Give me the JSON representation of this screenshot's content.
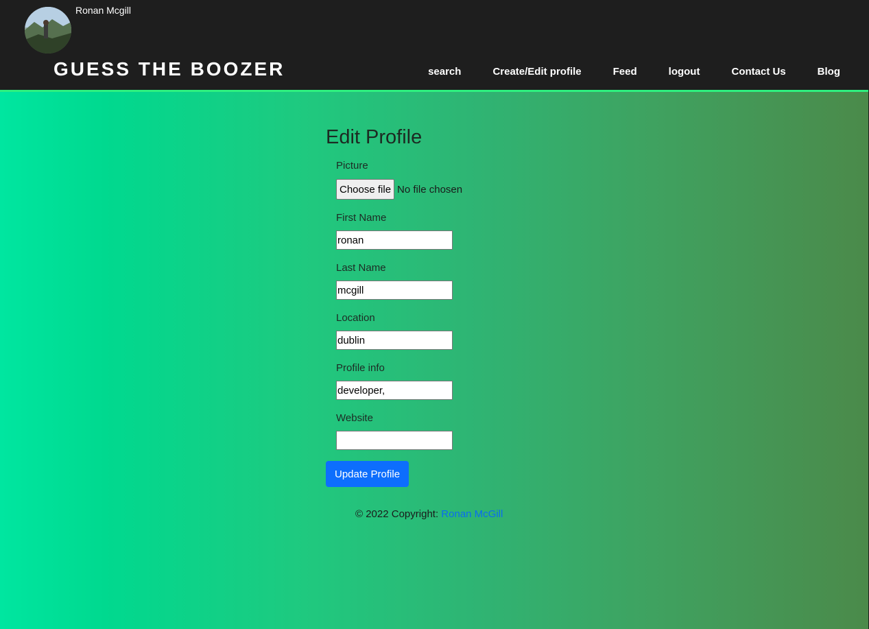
{
  "header": {
    "username": "Ronan Mcgill",
    "brand": "GUESS THE BOOZER",
    "nav": [
      "search",
      "Create/Edit profile",
      "Feed",
      "logout",
      "Contact Us",
      "Blog"
    ]
  },
  "form": {
    "title": "Edit Profile",
    "picture_label": "Picture",
    "choose_file_label": "Choose file",
    "file_status": "No file chosen",
    "fields": [
      {
        "label": "First Name",
        "value": "ronan"
      },
      {
        "label": "Last Name",
        "value": "mcgill"
      },
      {
        "label": "Location",
        "value": "dublin"
      },
      {
        "label": "Profile info",
        "value": "developer,"
      },
      {
        "label": "Website",
        "value": ""
      }
    ],
    "submit_label": "Update Profile"
  },
  "footer": {
    "copyright": "© 2022 Copyright: ",
    "author_link": "Ronan McGill"
  },
  "colors": {
    "header_bg": "#1e1e1e",
    "header_accent": "#2ef07f",
    "button_blue": "#0d6efd",
    "link_blue": "#0a6cf0"
  }
}
